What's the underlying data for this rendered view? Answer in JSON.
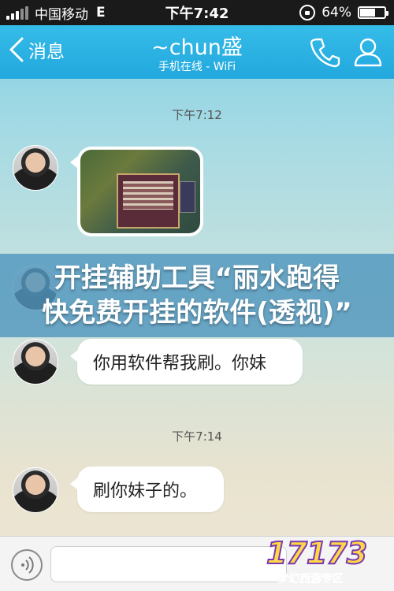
{
  "status_bar": {
    "carrier": "中国移动",
    "network": "E",
    "time": "下午7:42",
    "battery": "64%",
    "battery_level": 0.64
  },
  "nav": {
    "back_label": "消息",
    "title": "~chun盛",
    "subtitle": "手机在线 - WiFi",
    "phone_icon": "phone-icon",
    "contact_icon": "contact-icon",
    "accent": "#22a8dd"
  },
  "chat": {
    "timestamps": [
      "下午7:12",
      "下午7:14"
    ],
    "messages": [
      {
        "type": "image",
        "content": "game-screenshot"
      },
      {
        "type": "text",
        "text": "你用软件帮我刷。你妹"
      },
      {
        "type": "text",
        "text": "刷你妹子的。"
      }
    ]
  },
  "banner": {
    "line1": "开挂辅助工具“丽水跑得",
    "line2": "快免费开挂的软件(透视)”"
  },
  "input_bar": {
    "value": "",
    "placeholder": ""
  },
  "watermark": {
    "logo": "17173",
    "sub": "梦幻西游专区"
  }
}
